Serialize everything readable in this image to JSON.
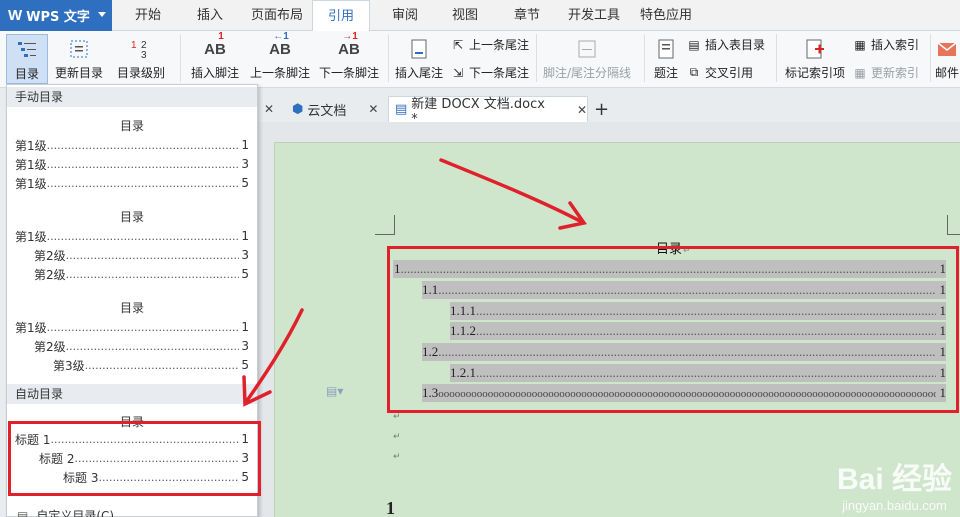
{
  "app": {
    "logo": "W",
    "name": "WPS 文字"
  },
  "menu_tabs": [
    "开始",
    "插入",
    "页面布局",
    "引用",
    "审阅",
    "视图",
    "章节",
    "开发工具",
    "特色应用"
  ],
  "ribbon": {
    "toc": "目录",
    "update_toc": "更新目录",
    "toc_level": "目录级别",
    "insert_footnote": "插入脚注",
    "prev_footnote": "上一条脚注",
    "next_footnote": "下一条脚注",
    "insert_endnote": "插入尾注",
    "prev_endnote": "上一条尾注",
    "next_endnote": "下一条尾注",
    "separator": "脚注/尾注分隔线",
    "caption": "题注",
    "insert_table_of_figures": "插入表目录",
    "cross_reference": "交叉引用",
    "mark_entry": "标记索引项",
    "insert_index": "插入索引",
    "update_index": "更新索引",
    "mail": "邮件"
  },
  "doc_tabs": [
    {
      "label": "云文档"
    },
    {
      "label": "新建 DOCX 文档.docx *"
    }
  ],
  "dropdown": {
    "manual_header": "手动目录",
    "auto_header": "自动目录",
    "custom_label": "自定义目录(C)...",
    "templates": [
      {
        "title": "目录",
        "lines": [
          {
            "text": "第1级",
            "page": "1"
          },
          {
            "text": "第1级",
            "page": "3"
          },
          {
            "text": "第1级",
            "page": "5"
          }
        ]
      },
      {
        "title": "目录",
        "lines": [
          {
            "text": "第1级",
            "page": "1"
          },
          {
            "text": "第2级",
            "page": "3"
          },
          {
            "text": "第2级",
            "page": "5"
          }
        ]
      },
      {
        "title": "目录",
        "lines": [
          {
            "text": "第1级",
            "page": "1"
          },
          {
            "text": "第2级",
            "page": "3"
          },
          {
            "text": "第3级",
            "page": "5"
          }
        ]
      },
      {
        "title": "目录",
        "lines": [
          {
            "text": "标题 1",
            "page": "1"
          },
          {
            "text": "标题 2",
            "page": "3"
          },
          {
            "text": "标题 3",
            "page": "5"
          }
        ]
      }
    ]
  },
  "document": {
    "title": "目录",
    "toc_entries": [
      {
        "text": "1",
        "page": "1"
      },
      {
        "text": "1.1",
        "page": "1"
      },
      {
        "text": "1.1.1",
        "page": "1"
      },
      {
        "text": "1.1.2",
        "page": "1"
      },
      {
        "text": "1.2",
        "page": "1"
      },
      {
        "text": "1.2.1",
        "page": "1"
      },
      {
        "text": "1.3",
        "page": "1"
      }
    ],
    "body_first_line": "1"
  },
  "watermark": {
    "brand": "Bai 经验",
    "url": "jingyan.baidu.com"
  },
  "colors": {
    "accent": "#2f6fbf",
    "highlight_red": "#e0202a",
    "page_bg": "#cfe6cc"
  }
}
